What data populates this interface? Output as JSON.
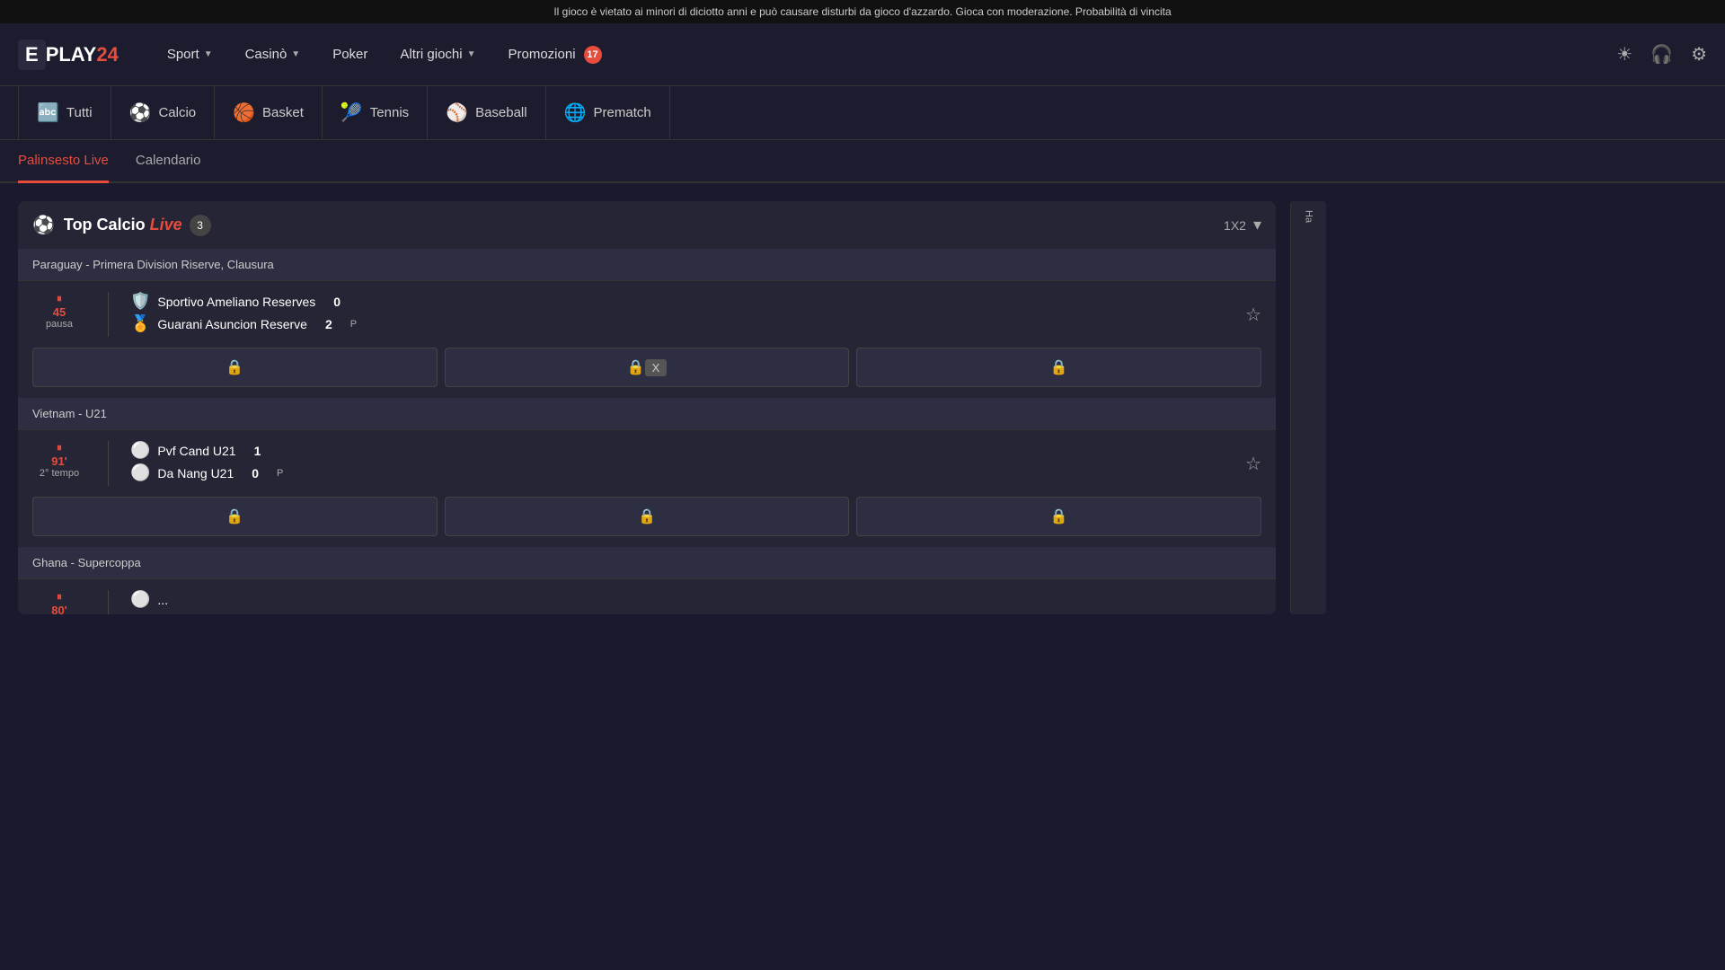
{
  "banner": {
    "text": "Il gioco è vietato ai minori di diciotto anni e può causare disturbi da gioco d'azzardo. Gioca con moderazione. Probabilità di vincita"
  },
  "logo": {
    "e": "E",
    "play": "PLAY",
    "num": "24"
  },
  "nav": {
    "items": [
      {
        "label": "Sport",
        "hasChevron": true
      },
      {
        "label": "Casinò",
        "hasChevron": true
      },
      {
        "label": "Poker",
        "hasChevron": false
      },
      {
        "label": "Altri giochi",
        "hasChevron": true
      },
      {
        "label": "Promozioni",
        "hasChevron": false,
        "badge": "17"
      }
    ]
  },
  "sports": [
    {
      "label": "Tutti",
      "icon": "🔤"
    },
    {
      "label": "Calcio",
      "icon": "⚽"
    },
    {
      "label": "Basket",
      "icon": "🏀"
    },
    {
      "label": "Tennis",
      "icon": "🎾"
    },
    {
      "label": "Baseball",
      "icon": "⚾"
    },
    {
      "label": "Prematch",
      "icon": "🌐"
    }
  ],
  "tabs": [
    {
      "label": "Palinsesto Live",
      "active": true
    },
    {
      "label": "Calendario",
      "active": false
    }
  ],
  "section": {
    "icon": "⚽",
    "title": "Top Calcio",
    "titleLive": "Live",
    "count": "3",
    "betType": "1X2"
  },
  "leagues": [
    {
      "name": "Paraguay - Primera Division Riserve, Clausura",
      "matches": [
        {
          "time": "45",
          "timePrefix": "⏸",
          "timeSub": "pausa",
          "team1": {
            "icon": "🛡️",
            "name": "Sportivo Ameliano Reserves",
            "score": "0"
          },
          "team2": {
            "icon": "🏅",
            "name": "Guarani Asuncion Reserve",
            "score": "2"
          },
          "extra": "P",
          "bets": [
            {
              "lock": true,
              "label": ""
            },
            {
              "lock": false,
              "label": "X"
            },
            {
              "lock": true,
              "label": ""
            }
          ]
        }
      ]
    },
    {
      "name": "Vietnam - U21",
      "matches": [
        {
          "time": "91'",
          "timePrefix": "⏸",
          "timeSub": "2° tempo",
          "team1": {
            "icon": "⚪",
            "name": "Pvf Cand U21",
            "score": "1"
          },
          "team2": {
            "icon": "⚪",
            "name": "Da Nang U21",
            "score": "0"
          },
          "extra": "P",
          "bets": [
            {
              "lock": true,
              "label": ""
            },
            {
              "lock": true,
              "label": ""
            },
            {
              "lock": true,
              "label": ""
            }
          ]
        }
      ]
    },
    {
      "name": "Ghana - Supercoppa",
      "matches": []
    }
  ],
  "sidebar": {
    "text": "Ha"
  }
}
